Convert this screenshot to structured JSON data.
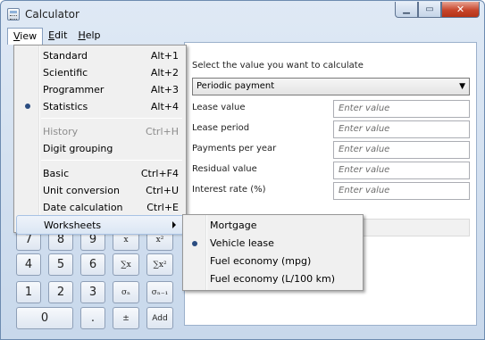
{
  "window": {
    "title": "Calculator"
  },
  "menubar": {
    "items": [
      {
        "label": "View",
        "underline": "V",
        "rest": "iew",
        "open": true
      },
      {
        "label": "Edit",
        "underline": "E",
        "rest": "dit",
        "open": false
      },
      {
        "label": "Help",
        "underline": "H",
        "rest": "elp",
        "open": false
      }
    ]
  },
  "view_menu": {
    "items": [
      {
        "label": "Standard",
        "shortcut": "Alt+1",
        "checked": false,
        "disabled": false
      },
      {
        "label": "Scientific",
        "shortcut": "Alt+2",
        "checked": false,
        "disabled": false
      },
      {
        "label": "Programmer",
        "shortcut": "Alt+3",
        "checked": false,
        "disabled": false
      },
      {
        "label": "Statistics",
        "shortcut": "Alt+4",
        "checked": true,
        "disabled": false
      },
      {
        "label": "History",
        "shortcut": "Ctrl+H",
        "checked": false,
        "disabled": true
      },
      {
        "label": "Digit grouping",
        "shortcut": "",
        "checked": false,
        "disabled": false
      },
      {
        "label": "Basic",
        "shortcut": "Ctrl+F4",
        "checked": false,
        "disabled": false
      },
      {
        "label": "Unit conversion",
        "shortcut": "Ctrl+U",
        "checked": false,
        "disabled": false
      },
      {
        "label": "Date calculation",
        "shortcut": "Ctrl+E",
        "checked": false,
        "disabled": false
      },
      {
        "label": "Worksheets",
        "shortcut": "",
        "checked": false,
        "disabled": false,
        "submenu": true,
        "highlighted": true
      }
    ]
  },
  "worksheets_menu": {
    "items": [
      {
        "label": "Mortgage",
        "checked": false
      },
      {
        "label": "Vehicle lease",
        "checked": true
      },
      {
        "label": "Fuel economy (mpg)",
        "checked": false
      },
      {
        "label": "Fuel economy (L/100 km)",
        "checked": false
      }
    ]
  },
  "worksheet": {
    "prompt": "Select the value you want to calculate",
    "selected_calc": "Periodic payment",
    "fields": [
      {
        "label": "Lease value",
        "placeholder": "Enter value"
      },
      {
        "label": "Lease period",
        "placeholder": "Enter value"
      },
      {
        "label": "Payments per year",
        "placeholder": "Enter value"
      },
      {
        "label": "Residual value",
        "placeholder": "Enter value"
      },
      {
        "label": "Interest rate (%)",
        "placeholder": "Enter value"
      }
    ]
  },
  "keypad": {
    "rows": [
      [
        "7",
        "8",
        "9",
        "x",
        "x²"
      ],
      [
        "4",
        "5",
        "6",
        "∑x",
        "∑x²"
      ],
      [
        "1",
        "2",
        "3",
        "σₙ",
        "σₙ₋₁"
      ],
      [
        "0",
        ".",
        "±",
        "Add"
      ]
    ]
  }
}
